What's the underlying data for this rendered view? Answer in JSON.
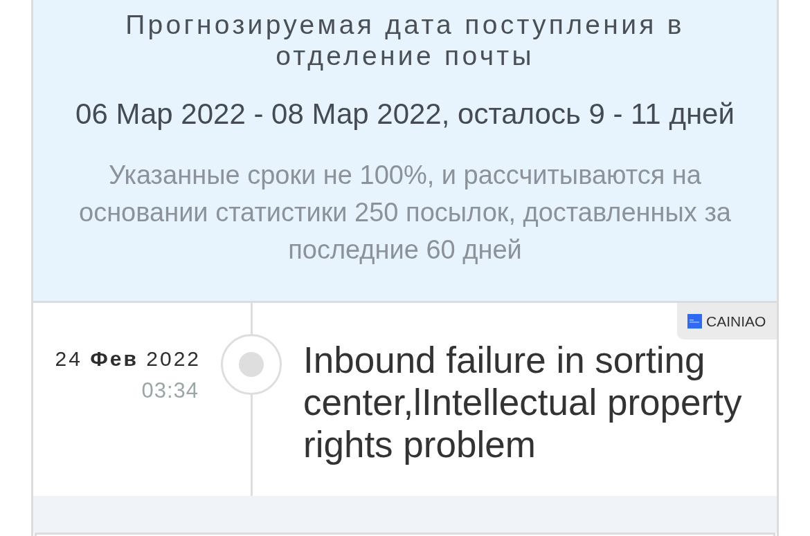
{
  "forecast": {
    "title": "Прогнозируемая дата поступления в отделение почты",
    "dates": "06 Мар 2022 - 08 Мар 2022, осталось 9 - 11 дней",
    "note": "Указанные сроки не 100%, и рассчитываются на основании статистики 250 посылок, доставленных за последние 60 дней"
  },
  "events": [
    {
      "date": "24 **Фев** 2022",
      "time": "03:34",
      "carrier": "CAINIAO",
      "description": "Inbound failure in sorting center,lIntellectual property rights problem"
    }
  ]
}
